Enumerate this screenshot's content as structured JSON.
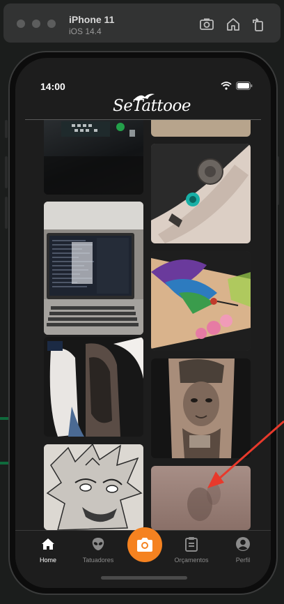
{
  "simulator": {
    "device": "iPhone 11",
    "os": "iOS 14.4"
  },
  "status": {
    "time": "14:00"
  },
  "app": {
    "logo_text": "SeTattooe"
  },
  "feed": {
    "images": [
      "laptop-keyboard-photo",
      "laptop-code-screen-photo",
      "sleeve-tattoo-woman-photo",
      "anime-character-sketch",
      "rose-compass-forearm-tattoo",
      "hummingbird-flowers-tattoo",
      "woman-portrait-sleeve-tattoo",
      "blurred-image"
    ]
  },
  "tabbar": {
    "tabs": [
      {
        "label": "Home",
        "icon": "home-icon",
        "active": true
      },
      {
        "label": "Tatuadores",
        "icon": "alien-icon",
        "active": false
      },
      {
        "label": "",
        "icon": "camera-icon",
        "active": false
      },
      {
        "label": "Orçamentos",
        "icon": "clipboard-icon",
        "active": false
      },
      {
        "label": "Perfil",
        "icon": "profile-icon",
        "active": false
      }
    ],
    "accent": "#f58220"
  },
  "annotation_color": "#e8392b"
}
